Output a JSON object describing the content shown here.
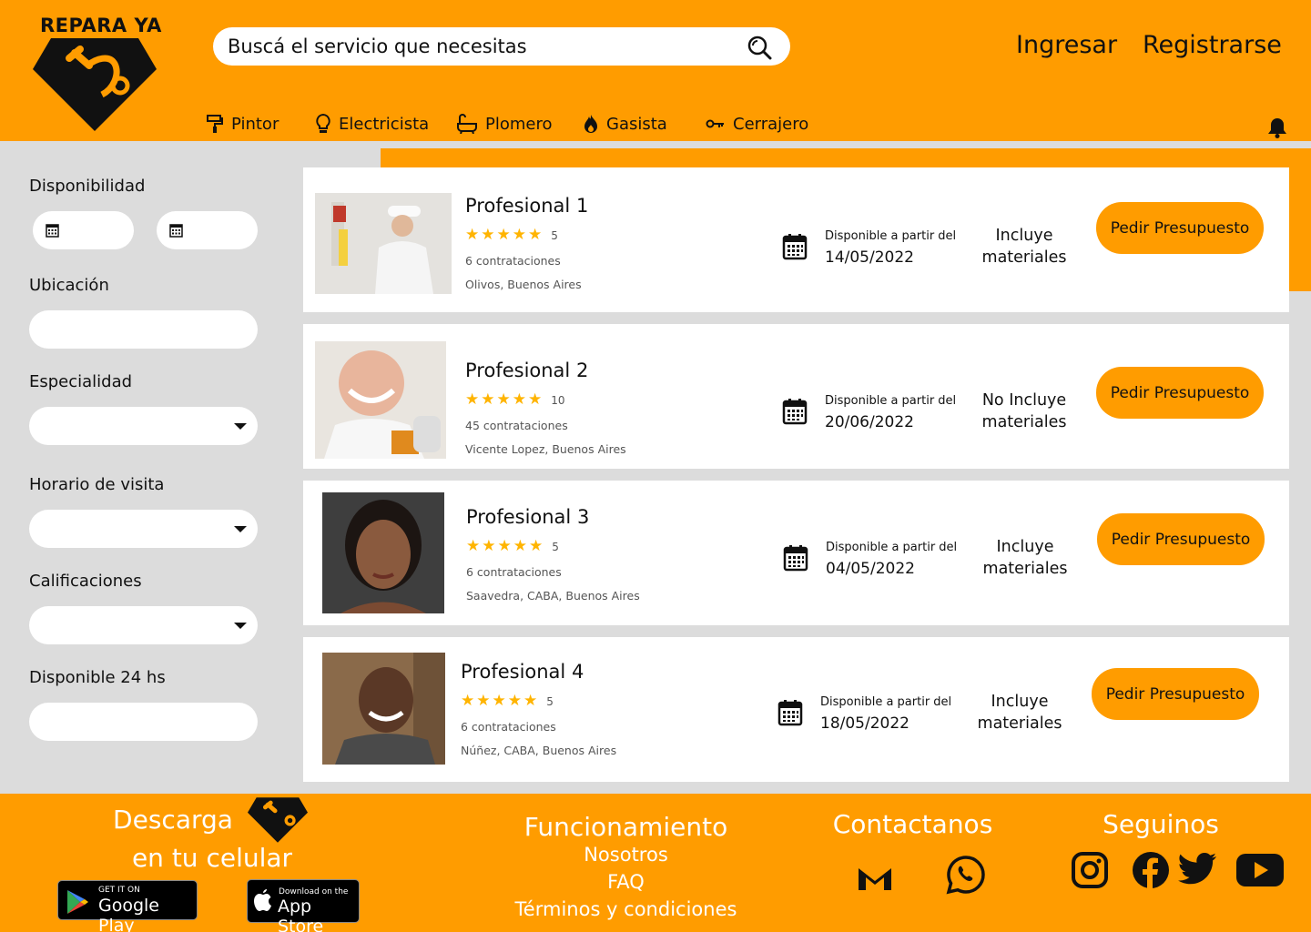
{
  "brand": {
    "name": "REPARA YA"
  },
  "search": {
    "placeholder": "Buscá el servicio que necesitas"
  },
  "auth": {
    "login": "Ingresar",
    "register": "Registrarse"
  },
  "categories": [
    {
      "label": "Pintor",
      "icon": "paint-roller-icon"
    },
    {
      "label": "Electricista",
      "icon": "lightbulb-icon"
    },
    {
      "label": "Plomero",
      "icon": "bathtub-icon"
    },
    {
      "label": "Gasista",
      "icon": "flame-icon"
    },
    {
      "label": "Cerrajero",
      "icon": "key-icon"
    }
  ],
  "filters": {
    "availability": "Disponibilidad",
    "location": "Ubicación",
    "specialty": "Especialidad",
    "visit_hours": "Horario de visita",
    "ratings": "Calificaciones",
    "available_24": "Disponible 24 hs"
  },
  "professionals": [
    {
      "name": "Profesional 1",
      "stars": 5,
      "reviews": "5",
      "hires": "6 contrataciones",
      "location": "Olivos, Buenos Aires",
      "avail_label": "Disponible a partir del",
      "date": "14/05/2022",
      "materials_1": "Incluye",
      "materials_2": "materiales",
      "cta": "Pedir Presupuesto"
    },
    {
      "name": "Profesional 2",
      "stars": 5,
      "reviews": "10",
      "hires": "45 contrataciones",
      "location": "Vicente Lopez, Buenos Aires",
      "avail_label": "Disponible a partir del",
      "date": "20/06/2022",
      "materials_1": "No Incluye",
      "materials_2": "materiales",
      "cta": "Pedir Presupuesto"
    },
    {
      "name": "Profesional 3",
      "stars": 5,
      "reviews": "5",
      "hires": "6 contrataciones",
      "location": "Saavedra, CABA, Buenos Aires",
      "avail_label": "Disponible a partir del",
      "date": "04/05/2022",
      "materials_1": "Incluye",
      "materials_2": "materiales",
      "cta": "Pedir Presupuesto"
    },
    {
      "name": "Profesional 4",
      "stars": 5,
      "reviews": "5",
      "hires": "6 contrataciones",
      "location": "Núñez, CABA, Buenos Aires",
      "avail_label": "Disponible a partir del",
      "date": "18/05/2022",
      "materials_1": "Incluye",
      "materials_2": "materiales",
      "cta": "Pedir Presupuesto"
    }
  ],
  "footer": {
    "download_1": "Descarga",
    "download_2": "en tu celular",
    "google_small": "GET IT ON",
    "google_big": "Google Play",
    "apple_small": "Download on the",
    "apple_big": "App Store",
    "how": "Funcionamiento",
    "about": "Nosotros",
    "faq": "FAQ",
    "terms": "Términos y condiciones",
    "contact": "Contactanos",
    "follow": "Seguinos"
  },
  "colors": {
    "accent": "#ff9c00",
    "background": "#dcdcdc",
    "star": "#ffb400"
  }
}
